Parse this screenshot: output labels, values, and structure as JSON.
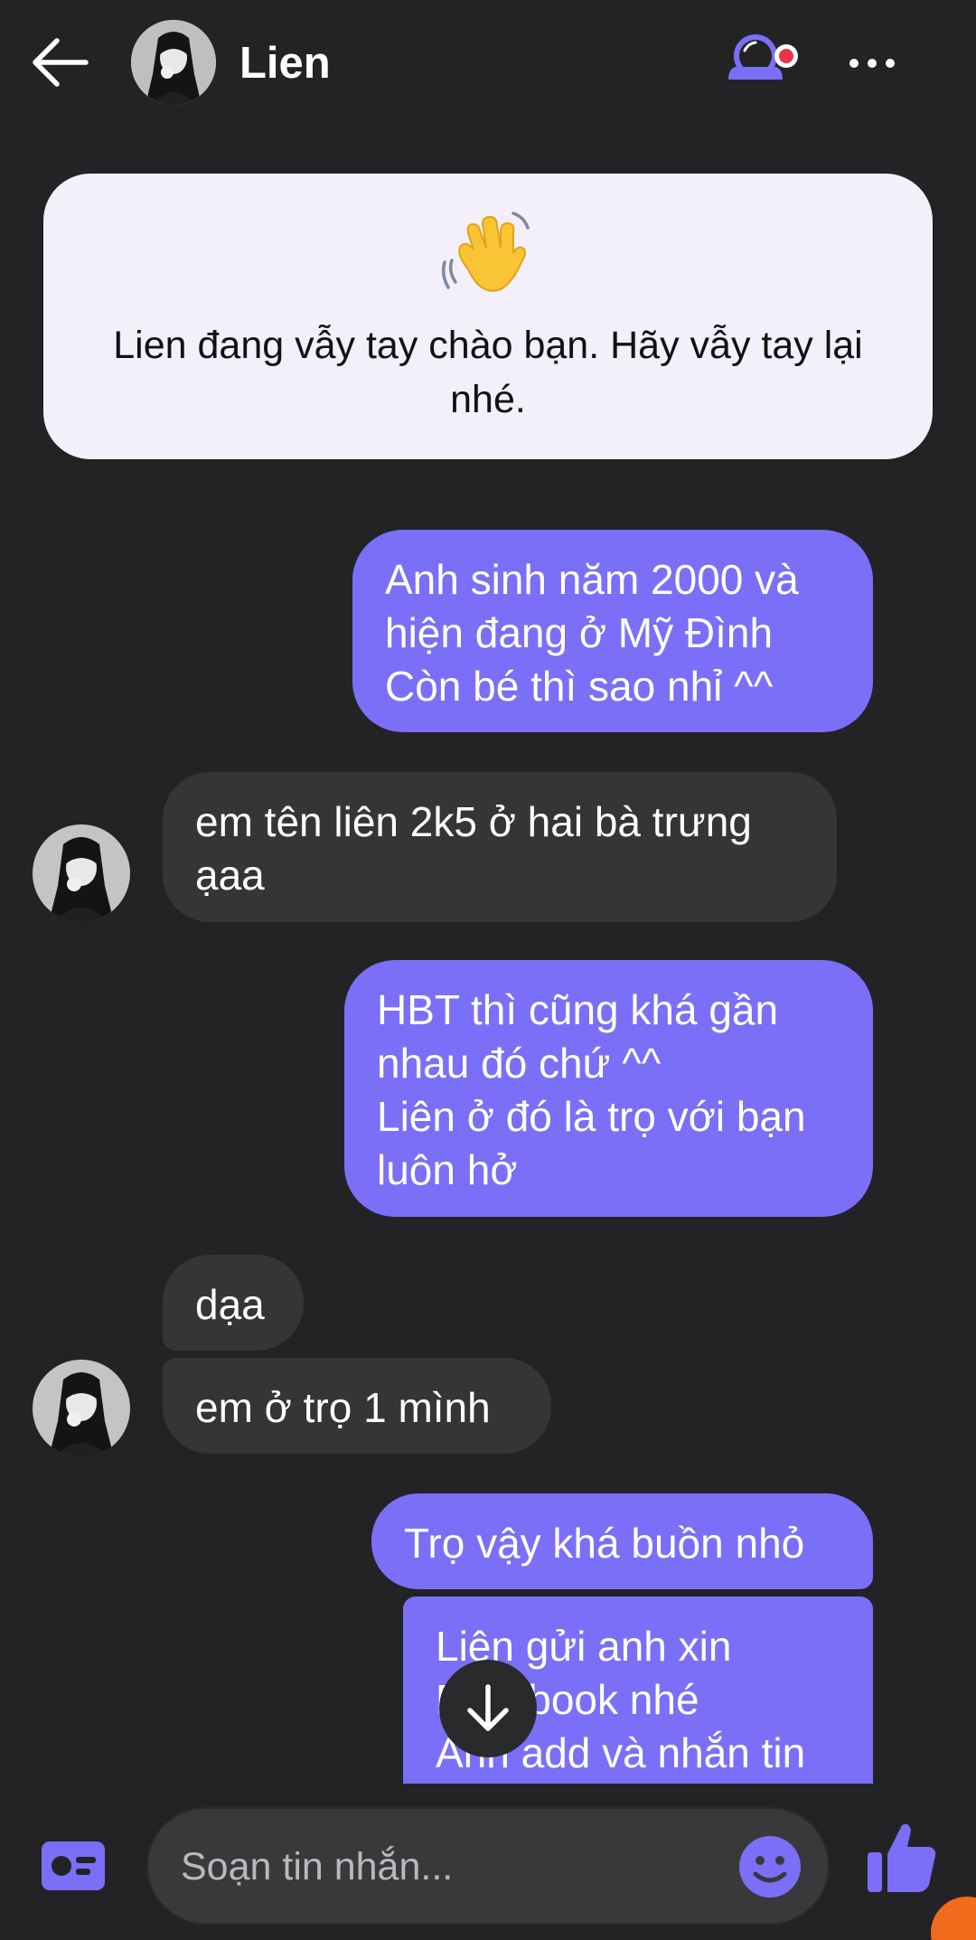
{
  "header": {
    "contact_name": "Lien",
    "back_icon": "back-arrow-icon",
    "stealth_icon": "secret-mode-icon",
    "more_icon": "more-options-icon",
    "accent_color": "#7b6ff7"
  },
  "wave_card": {
    "emoji": "waving-hand-emoji",
    "text": "Lien đang vẫy tay chào bạn. Hãy vẫy tay lại nhé."
  },
  "messages": [
    {
      "direction": "out",
      "text": "Anh sinh năm 2000 và\nhiện đang ở Mỹ Đình\nCòn bé thì sao nhỉ ^^"
    },
    {
      "direction": "in",
      "text": "em tên liên 2k5 ở hai bà trưng\nạaa"
    },
    {
      "direction": "out",
      "text": "HBT thì cũng khá gần\nnhau đó chứ ^^\nLiên ở đó là trọ với bạn\nluôn hở"
    },
    {
      "direction": "in",
      "text": "dạa"
    },
    {
      "direction": "in",
      "text": "em ở trọ 1 mình"
    },
    {
      "direction": "out",
      "text": "Trọ vậy khá buồn nhỏ"
    },
    {
      "direction": "out",
      "text": "Liên gửi anh xin\nFacebook nhé\nAnh add và nhắn tin"
    }
  ],
  "composer": {
    "placeholder": "Soạn tin nhắn...",
    "left_icon": "contact-card-icon",
    "emoji_icon": "emoji-smile-icon",
    "send_icon": "thumbs-up-icon"
  },
  "scroll_button_icon": "arrow-down-icon"
}
